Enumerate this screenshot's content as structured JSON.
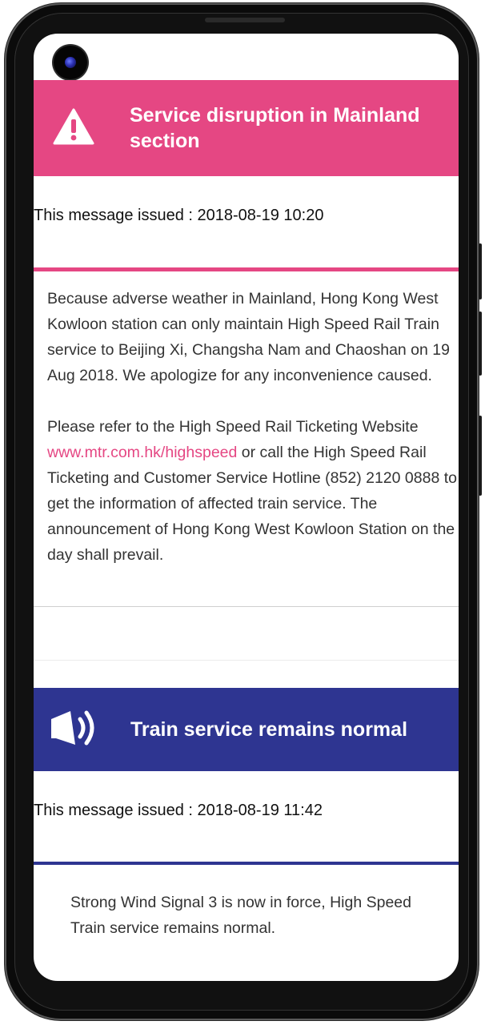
{
  "alerts": [
    {
      "title": "Service disruption in Mainland section",
      "icon": "warning-icon",
      "color": "#e54783",
      "issued": "This message issued : 2018-08-19 10:20",
      "para1": "Because adverse weather in Mainland, Hong Kong West Kowloon station can only maintain High Speed Rail Train service to Beijing Xi, Changsha Nam and Chaoshan on 19 Aug 2018. We apologize for any inconvenience caused.",
      "para2_before": "Please refer to the High Speed Rail Ticketing Website ",
      "para2_link": "www.mtr.com.hk/highspeed",
      "para2_after": " or call the High Speed Rail Ticketing and Customer Service Hotline (852) 2120 0888 to get the information of affected train service. The announcement of Hong Kong West Kowloon Station on the day shall prevail."
    },
    {
      "title": "Train service remains normal",
      "icon": "megaphone-icon",
      "color": "#2e3591",
      "issued": "This message issued : 2018-08-19 11:42",
      "para1": "Strong Wind Signal 3 is now in force, High Speed Train service remains normal."
    }
  ]
}
